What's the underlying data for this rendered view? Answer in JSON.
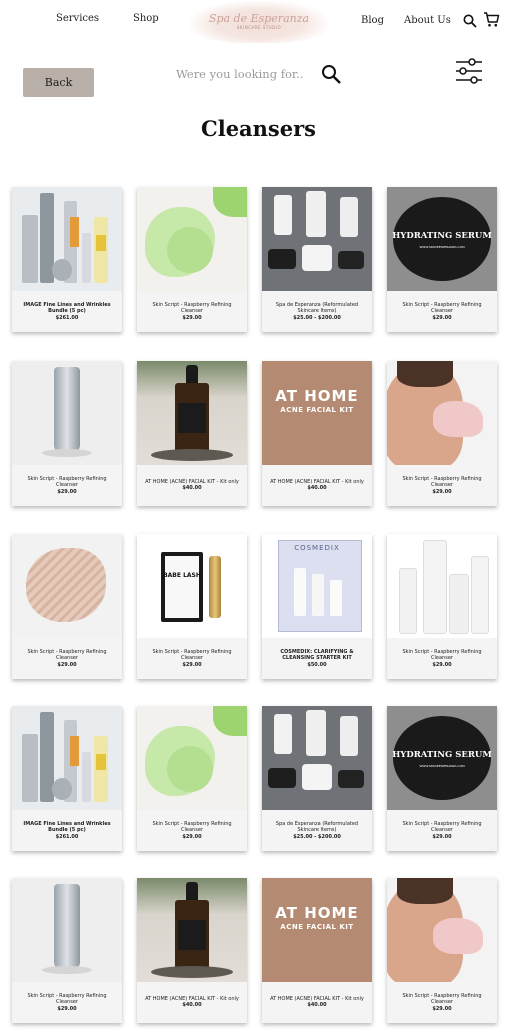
{
  "header": {
    "nav_services": "Services",
    "nav_shop": "Shop",
    "nav_blog": "Blog",
    "nav_about": "About Us",
    "logo_script": "Spa de Esperanza",
    "logo_sub": "SKINCARE STUDIO"
  },
  "toolbar": {
    "back_label": "Back",
    "search_placeholder": "Were you looking for.."
  },
  "page": {
    "title": "Cleansers"
  },
  "image_text": {
    "serum_label": "HYDRATING SERUM",
    "serum_small": "WWW.SPADEESPERANZA.COM",
    "kit_title": "AT HOME",
    "kit_sub": "ACNE FACIAL KIT",
    "lash_brand": "BABE LASH",
    "cosmedix_brand": "COSMEDIX"
  },
  "colors": {
    "back_button": "#b9afa9",
    "card_bg": "#f4f4f4",
    "kit_tan": "#b58a72"
  },
  "products": [
    {
      "name": "IMAGE Fine Lines and Wrinkles Bundle (5 pc)",
      "price": "$261.00",
      "bold": true
    },
    {
      "name": "Skin Script - Raspberry Refining Cleanser",
      "price": "$29.00",
      "bold": false
    },
    {
      "name": "Spa de Esperanza (Reformulated Skincare Items)",
      "price": "$25.00 - $200.00",
      "bold": false
    },
    {
      "name": "Skin Script - Raspberry Refining Cleanser",
      "price": "$29.00",
      "bold": false
    },
    {
      "name": "Skin Script - Raspberry Refining Cleanser",
      "price": "$29.00",
      "bold": false
    },
    {
      "name": "AT HOME (ACNE) FACIAL KIT - Kit only",
      "price": "$40.00",
      "bold": false
    },
    {
      "name": "AT HOME (ACNE) FACIAL KIT - Kit only",
      "price": "$40.00",
      "bold": false
    },
    {
      "name": "Skin Script - Raspberry Refining Cleanser",
      "price": "$29.00",
      "bold": false
    },
    {
      "name": "Skin Script - Raspberry Refining Cleanser",
      "price": "$29.00",
      "bold": false
    },
    {
      "name": "Skin Script - Raspberry Refining Cleanser",
      "price": "$29.00",
      "bold": false
    },
    {
      "name": "COSMEDIX: CLARIFYING & CLEANSING STARTER KIT",
      "price": "$50.00",
      "bold": true
    },
    {
      "name": "Skin Script - Raspberry Refining Cleanser",
      "price": "$29.00",
      "bold": false
    },
    {
      "name": "IMAGE Fine Lines and Wrinkles Bundle (5 pc)",
      "price": "$261.00",
      "bold": true
    },
    {
      "name": "Skin Script - Raspberry Refining Cleanser",
      "price": "$29.00",
      "bold": false
    },
    {
      "name": "Spa de Esperanza (Reformulated Skincare Items)",
      "price": "$25.00 - $200.00",
      "bold": false
    },
    {
      "name": "Skin Script - Raspberry Refining Cleanser",
      "price": "$29.00",
      "bold": false
    },
    {
      "name": "Skin Script - Raspberry Refining Cleanser",
      "price": "$29.00",
      "bold": false
    },
    {
      "name": "AT HOME (ACNE) FACIAL KIT - Kit only",
      "price": "$40.00",
      "bold": false
    },
    {
      "name": "AT HOME (ACNE) FACIAL KIT - Kit only",
      "price": "$40.00",
      "bold": false
    },
    {
      "name": "Skin Script - Raspberry Refining Cleanser",
      "price": "$29.00",
      "bold": false
    }
  ]
}
